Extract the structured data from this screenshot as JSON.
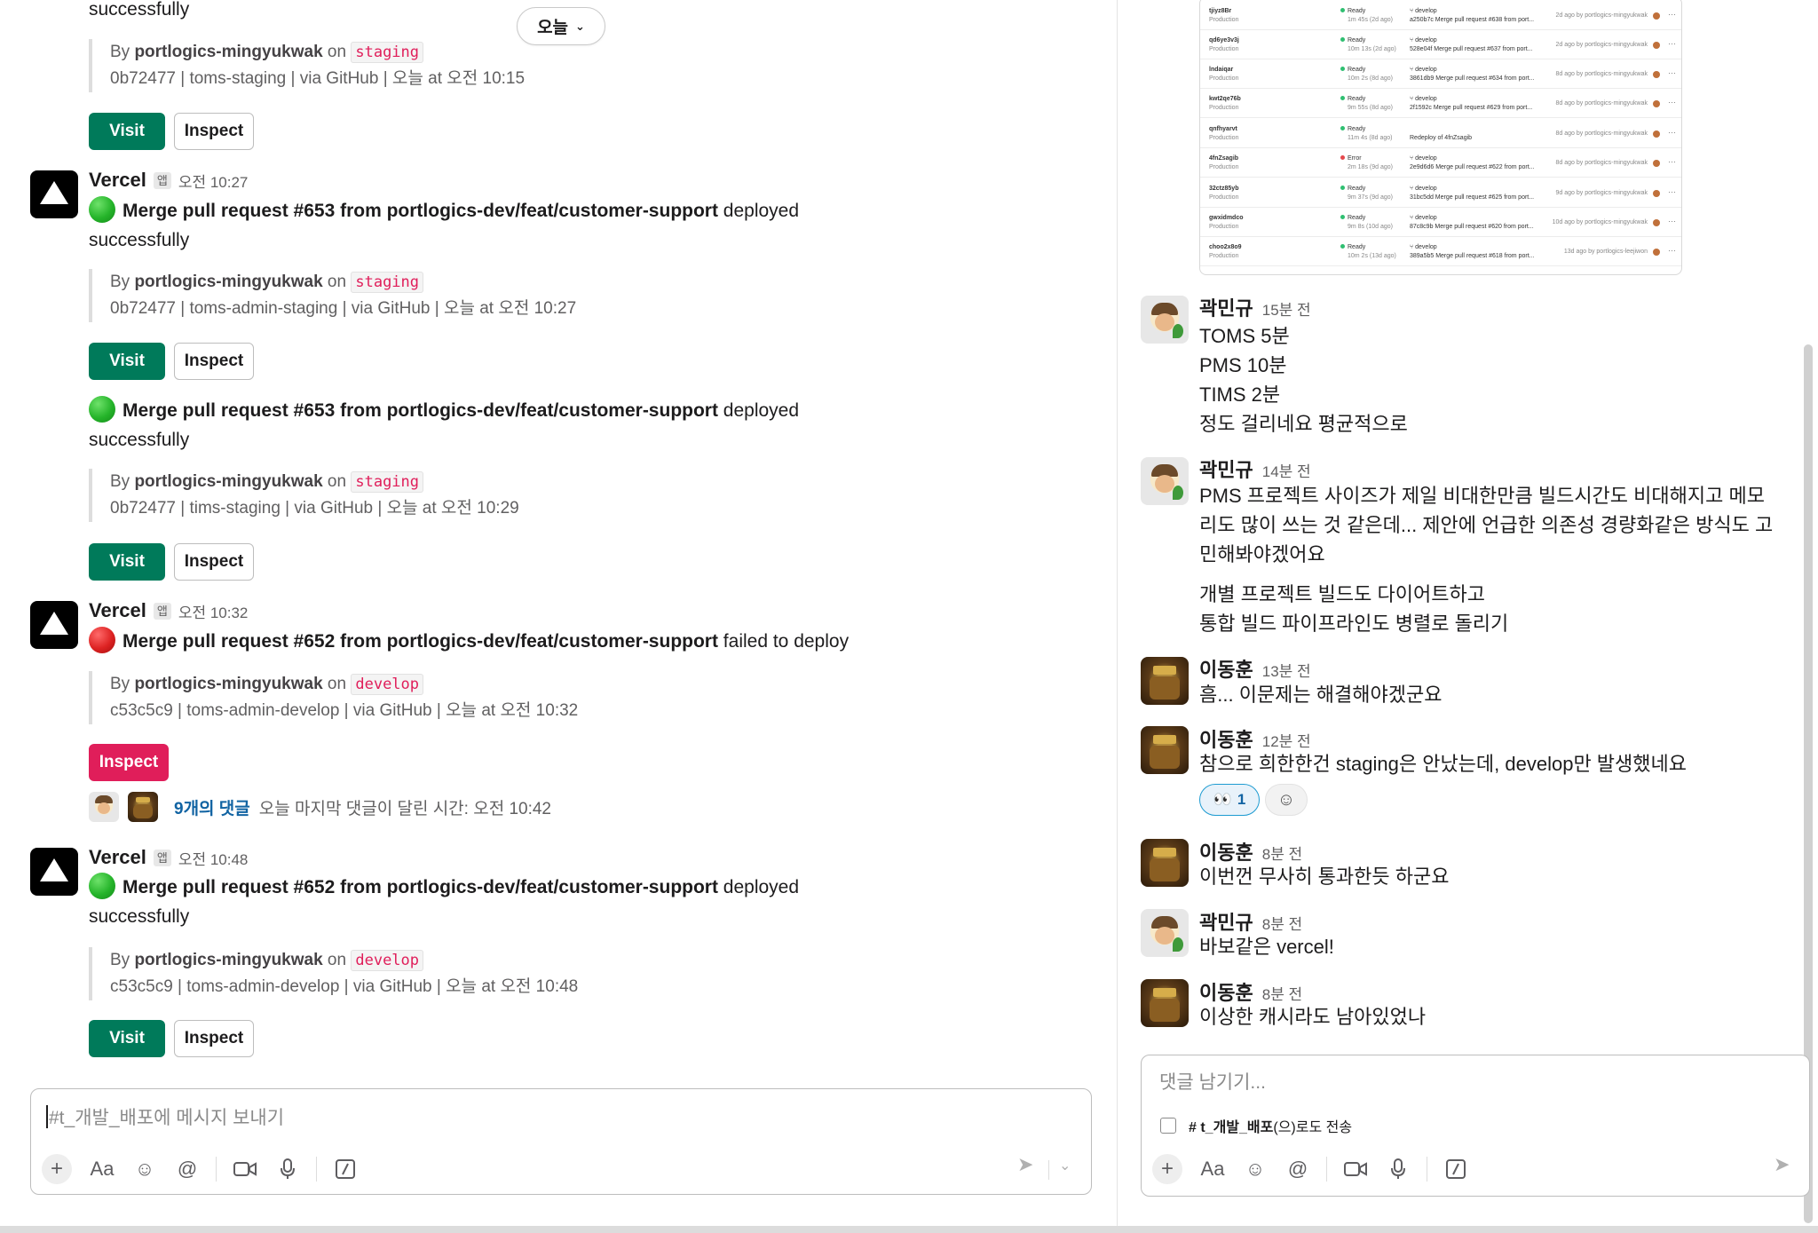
{
  "date_pill": {
    "label": "오늘",
    "chevron": "⌄"
  },
  "channel_messages": {
    "top_partial": {
      "body_tail": "successfully",
      "by_prefix": "By ",
      "author": "portlogics-mingyukwak",
      "on": " on ",
      "branch": "staging",
      "meta": "0b72477 | toms-staging | via GitHub | 오늘 at 오전 10:15",
      "visit": "Visit",
      "inspect": "Inspect"
    },
    "m1": {
      "sender": "Vercel",
      "app_badge": "앱",
      "time": "오전 10:27",
      "title": "Merge pull request #653 from portlogics-dev/feat/customer-support",
      "status_text": " deployed",
      "tail": "successfully",
      "by_prefix": "By ",
      "author": "portlogics-mingyukwak",
      "on": " on ",
      "branch": "staging",
      "meta": "0b72477 | toms-admin-staging | via GitHub | 오늘 at 오전 10:27",
      "visit": "Visit",
      "inspect": "Inspect"
    },
    "m1b": {
      "title": "Merge pull request #653 from portlogics-dev/feat/customer-support",
      "status_text": " deployed",
      "tail": "successfully",
      "by_prefix": "By ",
      "author": "portlogics-mingyukwak",
      "on": " on ",
      "branch": "staging",
      "meta": "0b72477 | tims-staging | via GitHub | 오늘 at 오전 10:29",
      "visit": "Visit",
      "inspect": "Inspect"
    },
    "m2": {
      "sender": "Vercel",
      "app_badge": "앱",
      "time": "오전 10:32",
      "title": "Merge pull request #652 from portlogics-dev/feat/customer-support",
      "status_text": " failed to deploy",
      "by_prefix": "By ",
      "author": "portlogics-mingyukwak",
      "on": " on ",
      "branch": "develop",
      "meta": "c53c5c9 | toms-admin-develop | via GitHub | 오늘 at 오전 10:32",
      "inspect": "Inspect",
      "thread_link": "9개의 댓글",
      "thread_meta": "오늘 마지막 댓글이 달린 시간: 오전 10:42"
    },
    "m3": {
      "sender": "Vercel",
      "app_badge": "앱",
      "time": "오전 10:48",
      "title": "Merge pull request #652 from portlogics-dev/feat/customer-support",
      "status_text": " deployed",
      "tail": "successfully",
      "by_prefix": "By ",
      "author": "portlogics-mingyukwak",
      "on": " on ",
      "branch": "develop",
      "meta": "c53c5c9 | toms-admin-develop | via GitHub | 오늘 at 오전 10:48",
      "visit": "Visit",
      "inspect": "Inspect"
    }
  },
  "composer": {
    "placeholder": "#t_개발_배포에 메시지 보내기",
    "tools": [
      "plus-icon",
      "format-icon",
      "emoji-icon",
      "mention-icon",
      "video-icon",
      "mic-icon",
      "slash-icon",
      "send-icon",
      "send-options-icon"
    ],
    "format_label": "Aa"
  },
  "thread_screenshot": {
    "rows": [
      {
        "id": "tjiyz8Br",
        "env": "Production",
        "status": "Ready",
        "dur": "1m 45s (2d ago)",
        "branch": "develop",
        "commit": "a250b7c  Merge pull request #638 from port...",
        "by": "2d ago by portlogics-mingyukwak"
      },
      {
        "id": "qd6ye3v3j",
        "env": "Production",
        "status": "Ready",
        "dur": "10m 13s (2d ago)",
        "branch": "develop",
        "commit": "528e04f  Merge pull request #637 from port...",
        "by": "2d ago by portlogics-mingyukwak"
      },
      {
        "id": "lndaiqar",
        "env": "Production",
        "status": "Ready",
        "dur": "10m 2s (8d ago)",
        "branch": "develop",
        "commit": "3861db9  Merge pull request #634 from port...",
        "by": "8d ago by portlogics-mingyukwak"
      },
      {
        "id": "kwt2qe76b",
        "env": "Production",
        "status": "Ready",
        "dur": "9m 55s (8d ago)",
        "branch": "develop",
        "commit": "2f1592c  Merge pull request #629 from port...",
        "by": "8d ago by portlogics-mingyukwak"
      },
      {
        "id": "qnfhyarvt",
        "env": "Production",
        "status": "Ready",
        "dur": "11m 4s (8d ago)",
        "branch": "",
        "commit": "Redeploy of 4fnZsagib",
        "by": "8d ago by portlogics-mingyukwak"
      },
      {
        "id": "4fnZsagib",
        "env": "Production",
        "status": "Error",
        "dur": "2m 18s (9d ago)",
        "branch": "develop",
        "commit": "2e9d6d6  Merge pull request #622 from port...",
        "by": "8d ago by portlogics-mingyukwak"
      },
      {
        "id": "32ctz85yb",
        "env": "Production",
        "status": "Ready",
        "dur": "9m 37s (9d ago)",
        "branch": "develop",
        "commit": "31bc5dd  Merge pull request #625 from port...",
        "by": "9d ago by portlogics-mingyukwak"
      },
      {
        "id": "gwxidmdco",
        "env": "Production",
        "status": "Ready",
        "dur": "9m 8s (10d ago)",
        "branch": "develop",
        "commit": "87c8c9b  Merge pull request #620 from port...",
        "by": "10d ago by portlogics-mingyukwak"
      },
      {
        "id": "choo2x8o9",
        "env": "Production",
        "status": "Ready",
        "dur": "10m 2s (13d ago)",
        "branch": "develop",
        "commit": "389a5b5  Merge pull request #618 from port...",
        "by": "13d ago by portlogics-leejiwon"
      }
    ]
  },
  "thread": {
    "messages": [
      {
        "author": "곽민규",
        "time": "15분 전",
        "lines": [
          "TOMS 5분",
          "PMS 10분",
          "TIMS 2분",
          "정도 걸리네요 평균적으로"
        ]
      },
      {
        "author": "곽민규",
        "time": "14분 전",
        "lines": [
          "PMS 프로젝트 사이즈가 제일 비대한만큼 빌드시간도 비대해지고 메모",
          "리도 많이 쓰는 것 같은데... 제안에 언급한 의존성 경량화같은 방식도 고",
          "민해봐야겠어요"
        ],
        "extra": [
          "개별 프로젝트 빌드도 다이어트하고",
          "통합 빌드 파이프라인도 병렬로 돌리기"
        ]
      },
      {
        "author": "이동훈",
        "time": "13분 전",
        "lines": [
          "흠... 이문제는 해결해야겠군요"
        ]
      },
      {
        "author": "이동훈",
        "time": "12분 전",
        "lines": [
          "참으로 희한한건 staging은 안났는데, develop만 발생했네요"
        ]
      },
      {
        "author": "이동훈",
        "time": "8분 전",
        "lines": [
          "이번껀 무사히 통과한듯 하군요"
        ]
      },
      {
        "author": "곽민규",
        "time": "8분 전",
        "lines": [
          "바보같은 vercel!"
        ]
      },
      {
        "author": "이동훈",
        "time": "8분 전",
        "lines": [
          "이상한 캐시라도 남아있었나"
        ]
      }
    ],
    "reaction": {
      "emoji": "👀",
      "count": "1"
    },
    "composer_placeholder": "댓글 남기기...",
    "also_send_channel": "# t_개발_배포",
    "also_send_suffix": "(으)로도 전송"
  },
  "colors": {
    "visit_green": "#007a5a",
    "danger": "#e01e5a",
    "link": "#1264a3",
    "code_red": "#e01e5a"
  }
}
